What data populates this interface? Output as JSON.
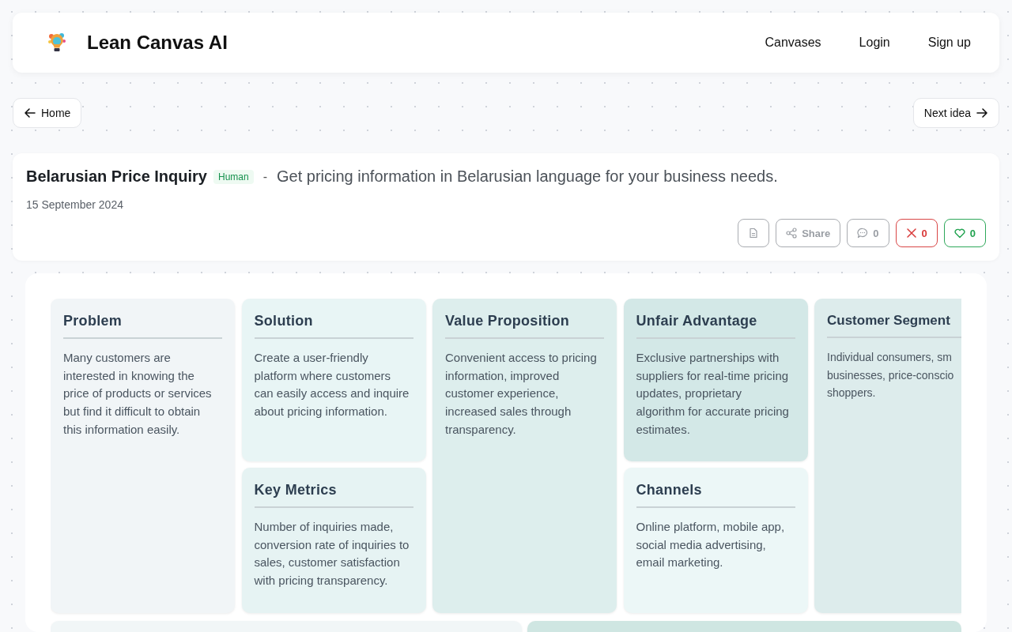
{
  "header": {
    "brand": "Lean Canvas AI",
    "nav": [
      "Canvases",
      "Login",
      "Sign up"
    ]
  },
  "navigation": {
    "back": "Home",
    "next": "Next idea"
  },
  "idea": {
    "title": "Belarusian Price Inquiry",
    "badge": "Human",
    "separator": "-",
    "tagline": "Get pricing information in Belarusian language for your business needs.",
    "date": "15 September 2024",
    "actions": [
      {
        "kind": "document"
      },
      {
        "kind": "share",
        "label": "Share"
      },
      {
        "kind": "comments",
        "count": "0"
      },
      {
        "kind": "dislike",
        "count": "0"
      },
      {
        "kind": "like",
        "count": "0"
      }
    ]
  },
  "canvas": {
    "blocks": [
      {
        "kind": "problem",
        "title": "Problem",
        "lines": [
          "Many customers are",
          "interested in knowing the",
          "price of products or services",
          "but find it difficult to obtain",
          "this information easily."
        ]
      },
      {
        "kind": "solution",
        "title": "Solution",
        "lines": [
          "Create a user-friendly",
          "platform where customers",
          "can easily access and inquire",
          "about pricing information."
        ]
      },
      {
        "kind": "value",
        "title": "Value Proposition",
        "lines": [
          "Convenient access to pricing",
          "information, improved",
          "customer experience,",
          "increased sales through",
          "transparency."
        ]
      },
      {
        "kind": "unfair",
        "title": "Unfair Advantage",
        "lines": [
          "Exclusive partnerships with",
          "suppliers for real-time pricing",
          "updates, proprietary",
          "algorithm for accurate pricing",
          "estimates."
        ]
      },
      {
        "kind": "segments",
        "title": "Customer Segment",
        "lines": [
          "Individual consumers, sm",
          "businesses, price-conscio",
          "shoppers."
        ]
      },
      {
        "kind": "metrics",
        "title": "Key Metrics",
        "lines": [
          "Number of inquiries made,",
          "conversion rate of inquiries to",
          "sales, customer satisfaction",
          "with pricing transparency."
        ]
      },
      {
        "kind": "channels",
        "title": "Channels",
        "lines": [
          "Online platform, mobile app,",
          "social media advertising,",
          "email marketing."
        ]
      },
      {
        "kind": "cost"
      },
      {
        "kind": "revenue"
      }
    ]
  }
}
